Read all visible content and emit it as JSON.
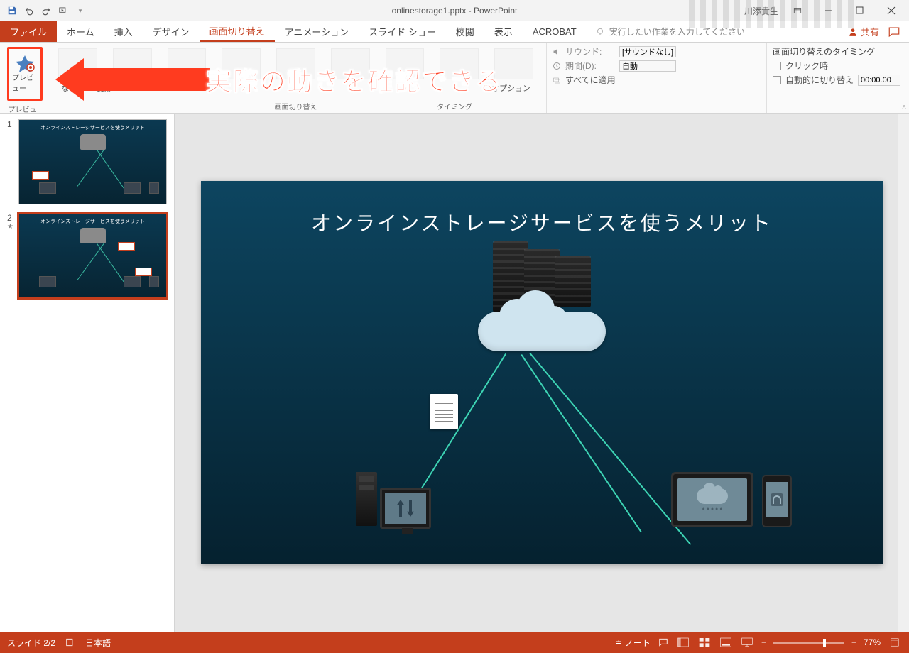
{
  "titlebar": {
    "filename": "onlinestorage1.pptx - PowerPoint",
    "username": "川添貴生"
  },
  "tabs": {
    "file": "ファイル",
    "home": "ホーム",
    "insert": "挿入",
    "design": "デザイン",
    "transitions": "画面切り替え",
    "animations": "アニメーション",
    "slideshow": "スライド ショー",
    "review": "校閲",
    "view": "表示",
    "acrobat": "ACROBAT",
    "tell_me": "実行したい作業を入力してください",
    "share": "共有"
  },
  "ribbon": {
    "preview": "プレビュー",
    "preview_group": "プレビュー",
    "trans_none": "なし",
    "trans_morph": "変形",
    "trans_group": "画面切り替え",
    "options": "オプション",
    "sound": "サウンド:",
    "sound_val": "[サウンドなし]",
    "duration": "期間(D):",
    "duration_val": "自動",
    "apply_all": "すべてに適用",
    "timing_hdr": "画面切り替えのタイミング",
    "on_click": "クリック時",
    "after": "自動的に切り替え",
    "after_val": "00:00.00",
    "timing_group": "タイミング"
  },
  "callout": "実際の動きを確認できる",
  "thumbs": {
    "title": "オンラインストレージサービスを使うメリット"
  },
  "slide": {
    "title": "オンラインストレージサービスを使うメリット"
  },
  "status": {
    "slide": "スライド 2/2",
    "lang": "日本語",
    "notes": "ノート",
    "zoom": "77%"
  }
}
